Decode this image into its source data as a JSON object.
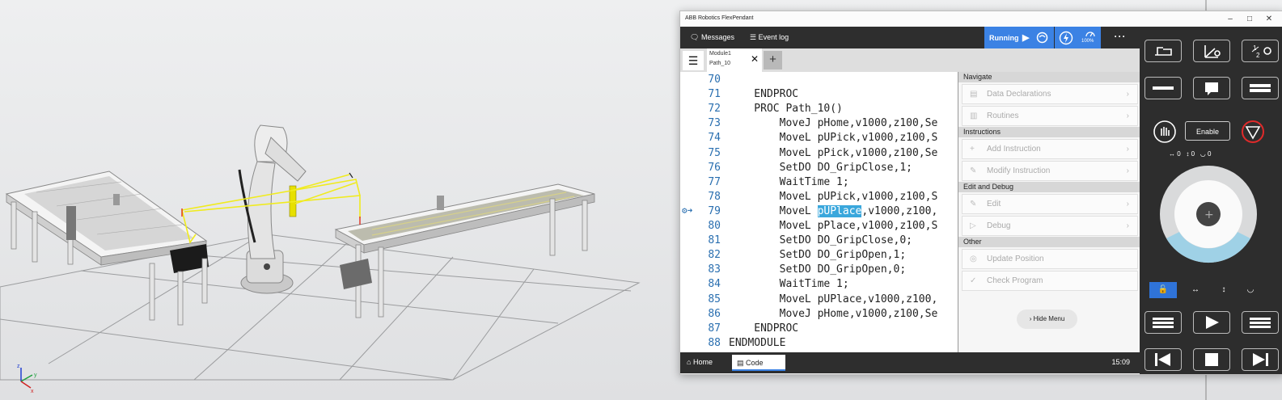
{
  "window": {
    "title": "ABB Robotics FlexPendant",
    "controls": [
      "–",
      "□",
      "✕"
    ]
  },
  "topbar": {
    "messages_label": "Messages",
    "eventlog_label": "Event log",
    "status_label": "Running",
    "speed_label": "100%",
    "more_label": "···"
  },
  "tabs": {
    "module_label": "Module1",
    "routine_label": "Path_10",
    "close": "✕",
    "add": "+"
  },
  "code": {
    "current_line": 79,
    "lines": [
      {
        "num": "70",
        "text": ""
      },
      {
        "num": "71",
        "text": "    ENDPROC"
      },
      {
        "num": "72",
        "text": "    PROC Path_10()"
      },
      {
        "num": "73",
        "text": "        MoveJ pHome,v1000,z100,Se"
      },
      {
        "num": "74",
        "text": "        MoveL pUPick,v1000,z100,S"
      },
      {
        "num": "75",
        "text": "        MoveL pPick,v1000,z100,Se"
      },
      {
        "num": "76",
        "text": "        SetDO DO_GripClose,1;"
      },
      {
        "num": "77",
        "text": "        WaitTime 1;"
      },
      {
        "num": "78",
        "text": "        MoveL pUPick,v1000,z100,S"
      },
      {
        "num": "79",
        "text": "        MoveL ",
        "highlight": "pUPlace",
        "after": ",v1000,z100,"
      },
      {
        "num": "80",
        "text": "        MoveL pPlace,v1000,z100,S"
      },
      {
        "num": "81",
        "text": "        SetDO DO_GripClose,0;"
      },
      {
        "num": "82",
        "text": "        SetDO DO_GripOpen,1;"
      },
      {
        "num": "83",
        "text": "        SetDO DO_GripOpen,0;"
      },
      {
        "num": "84",
        "text": "        WaitTime 1;"
      },
      {
        "num": "85",
        "text": "        MoveL pUPlace,v1000,z100,"
      },
      {
        "num": "86",
        "text": "        MoveJ pHome,v1000,z100,Se"
      },
      {
        "num": "87",
        "text": "    ENDPROC"
      },
      {
        "num": "88",
        "text": "ENDMODULE"
      }
    ]
  },
  "menu": {
    "sections": {
      "navigate": "Navigate",
      "instructions": "Instructions",
      "edit_debug": "Edit and Debug",
      "other": "Other"
    },
    "items": {
      "data_declarations": "Data Declarations",
      "routines": "Routines",
      "add_instruction": "Add Instruction",
      "modify_instruction": "Modify Instruction",
      "edit": "Edit",
      "debug": "Debug",
      "update_position": "Update Position",
      "check_program": "Check Program"
    },
    "hide_label": "Hide Menu"
  },
  "bottombar": {
    "home_label": "Home",
    "code_label": "Code",
    "time": "15:09"
  },
  "sidepanel": {
    "enable_label": "Enable",
    "axis_readout": {
      "x": "0",
      "y": "0",
      "z": "0"
    }
  },
  "colors": {
    "accent": "#3b82e4",
    "highlight": "#3aa7dc",
    "dark": "#2e2e2e",
    "line_number": "#2a6fb0"
  }
}
